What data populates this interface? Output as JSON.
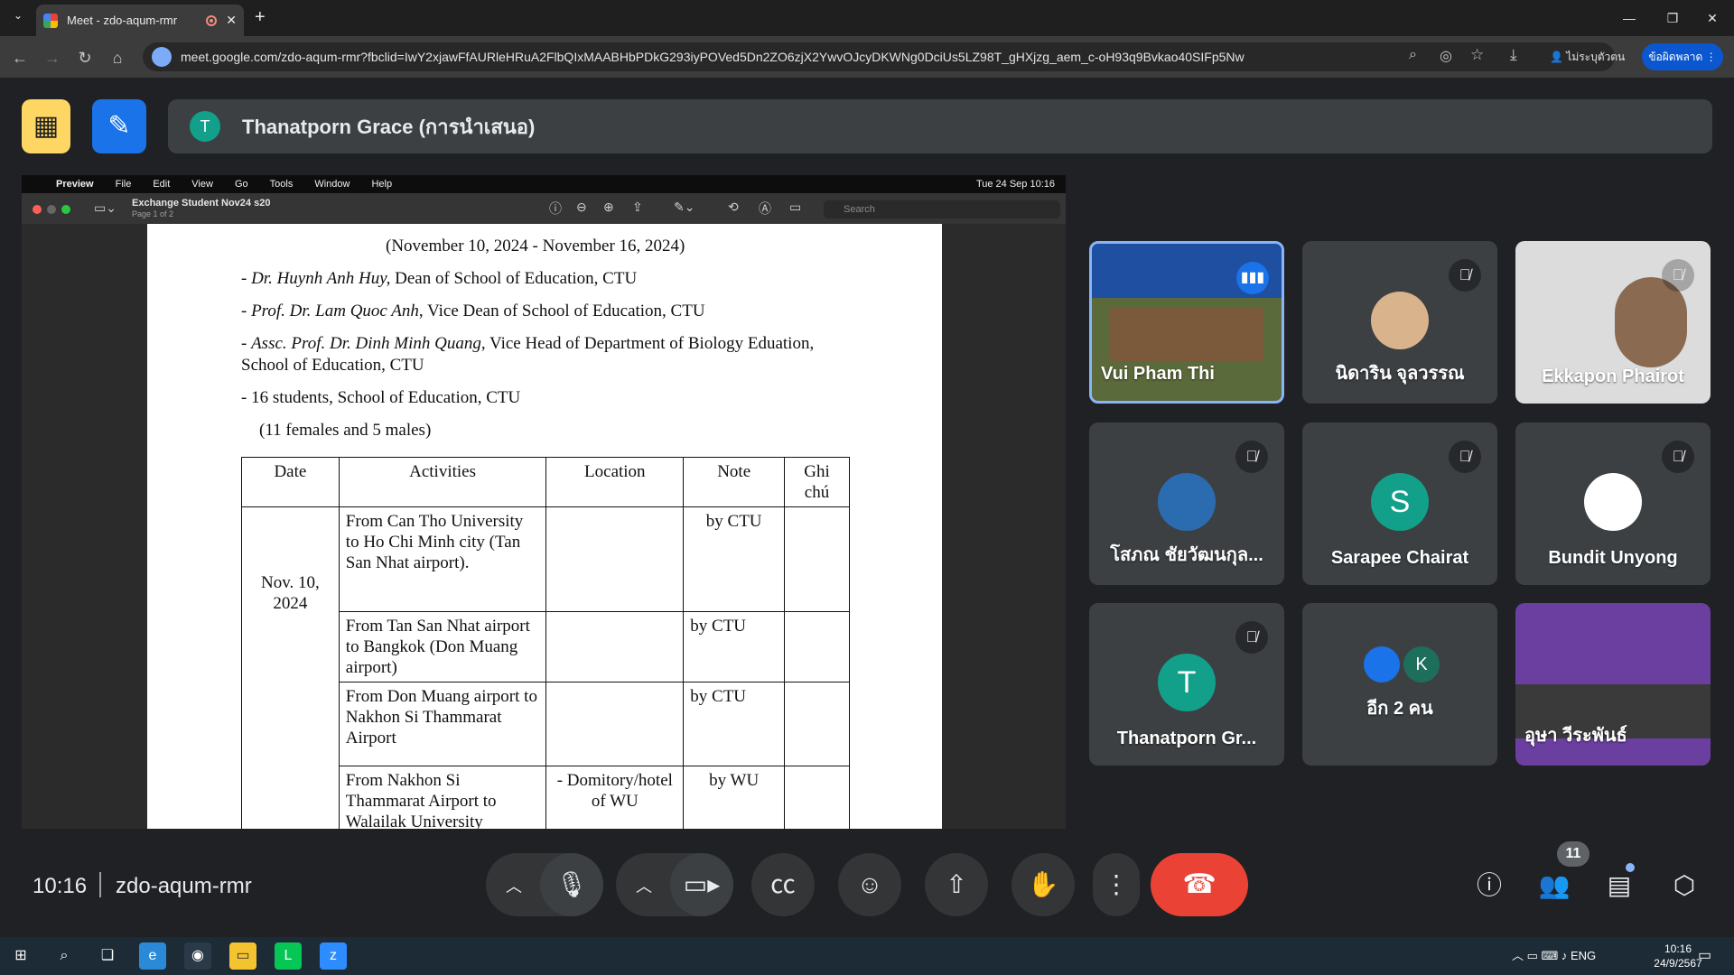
{
  "browser": {
    "tab_title": "Meet - zdo-aqum-rmr",
    "url": "meet.google.com/zdo-aqum-rmr?fbclid=IwY2xjawFfAURleHRuA2FlbQIxMAABHbPDkG293iyPOVed5Dn2ZO6zjX2YwvOJcyDKWNg0DciUs5LZ98T_gHXjzg_aem_c-oH93q9Bvkao40SIFp5Nw",
    "profile_label": "ไม่ระบุตัวตน",
    "update_label": "ข้อผิดพลาด"
  },
  "meet": {
    "presenter_initial": "T",
    "presenter_label": "Thanatporn Grace (การนำเสนอ)",
    "time": "10:16",
    "meeting_code": "zdo-aqum-rmr",
    "participant_count": "11"
  },
  "shared_screen": {
    "mac_menu": [
      "Preview",
      "File",
      "Edit",
      "View",
      "Go",
      "Tools",
      "Window",
      "Help"
    ],
    "mac_clock": "Tue 24 Sep  10:16",
    "doc_title": "Exchange Student Nov24 s20",
    "doc_page": "Page 1 of 2",
    "search_placeholder": "Search",
    "date_range": "(November 10, 2024 - November 16, 2024)",
    "people": [
      {
        "name": "Dr. Huynh Anh Huy,",
        "role": " Dean of  School of Education, CTU"
      },
      {
        "name": "Prof. Dr. Lam Quoc Anh",
        "role": ", Vice Dean of  School of Education, CTU"
      },
      {
        "name": "Assc. Prof. Dr. Dinh Minh Quang",
        "role": ", Vice Head of Department of Biology Eduation,"
      }
    ],
    "people_cont": "School of Education, CTU",
    "students": "- 16 students,  School of Education, CTU",
    "students_breakdown": "(11 females and 5 males)",
    "table_headers": [
      "Date",
      "Activities",
      "Location",
      "Note",
      "Ghi chú"
    ],
    "table_date": "Nov. 10, 2024",
    "table_rows": [
      {
        "activity": "From Can Tho University to Ho Chi Minh city (Tan San Nhat airport).",
        "location": "",
        "note": "by CTU"
      },
      {
        "activity": "From Tan San Nhat airport to Bangkok (Don Muang airport)",
        "location": "",
        "note": "by CTU"
      },
      {
        "activity": "From Don Muang airport to Nakhon Si Thammarat Airport",
        "location": "",
        "note": "by CTU"
      },
      {
        "activity": "From Nakhon Si Thammarat Airport to Walailak University",
        "location": "- Domitory/hotel of  WU",
        "note": "by WU"
      }
    ]
  },
  "tiles": [
    {
      "name": "Vui Pham Thi",
      "initial": "",
      "color": "#5b6a3a",
      "muted": false,
      "speaking": true
    },
    {
      "name": "นิดาริน จุลวรรณ",
      "initial": "",
      "color": "#d9b38c",
      "muted": true
    },
    {
      "name": "Ekkapon Phairot",
      "initial": "",
      "color": "#cfcfcf",
      "muted": true
    },
    {
      "name": "โสภณ ชัยวัฒนกุล...",
      "initial": "",
      "color": "#2b6cb0",
      "muted": true
    },
    {
      "name": "Sarapee Chairat",
      "initial": "S",
      "color": "#12a08a",
      "muted": true
    },
    {
      "name": "Bundit Unyong",
      "initial": "",
      "color": "#ffffff",
      "muted": true
    },
    {
      "name": "Thanatporn Gr...",
      "initial": "T",
      "color": "#12a08a",
      "muted": true
    },
    {
      "name": "อีก 2 คน",
      "initial": "K",
      "color": "#1e6e5c",
      "muted": false
    },
    {
      "name": "อุษา วีระพันธ์",
      "initial": "",
      "color": "#6b3fa0",
      "muted": false
    }
  ],
  "taskbar": {
    "lang": "ENG",
    "time": "10:16",
    "date": "24/9/2567"
  }
}
